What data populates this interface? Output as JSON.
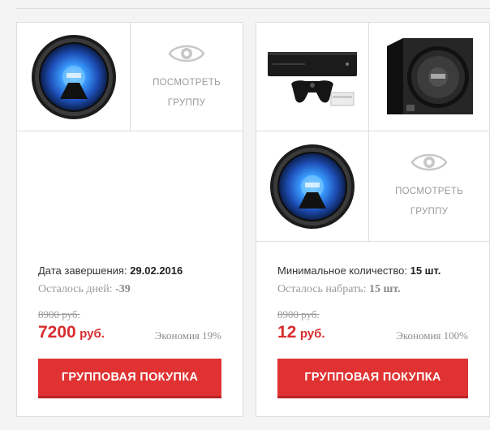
{
  "colors": {
    "accent": "#e03232",
    "price": "#d72d2f",
    "border": "#dedede",
    "muted": "#9a9a9a"
  },
  "cards": [
    {
      "view": {
        "line1": "ПОСМОТРЕТЬ",
        "line2": "ГРУППУ"
      },
      "images": [
        "subwoofer-speaker"
      ],
      "info_label": "Дата завершения: ",
      "info_value": "29.02.2016",
      "remain_label": "Осталось дней: ",
      "remain_value": "-39",
      "old_price": "8900 руб.",
      "price_num": "7200",
      "price_cur": "руб.",
      "economy": "Экономия 19%",
      "button": "ГРУППОВАЯ ПОКУПКА"
    },
    {
      "view": {
        "line1": "ПОСМОТРЕТЬ",
        "line2": "ГРУППУ"
      },
      "images": [
        "game-console",
        "subwoofer-box",
        "subwoofer-speaker"
      ],
      "info_label": "Минимальное количество: ",
      "info_value": "15 шт.",
      "remain_label": "Осталось набрать: ",
      "remain_value": "15 шт.",
      "old_price": "8900 руб.",
      "price_num": "12",
      "price_cur": "руб.",
      "economy": "Экономия 100%",
      "button": "ГРУППОВАЯ ПОКУПКА"
    }
  ]
}
